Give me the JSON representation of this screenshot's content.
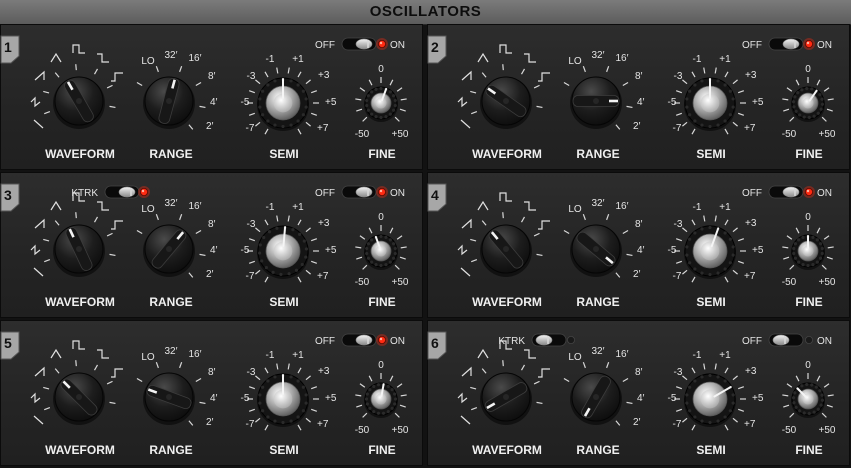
{
  "header": {
    "title": "OSCILLATORS"
  },
  "labels": {
    "waveform": "WAVEFORM",
    "range": "RANGE",
    "semi": "SEMI",
    "fine": "FINE",
    "off": "OFF",
    "on": "ON",
    "ktrk": "KTRK"
  },
  "range_marks": [
    "LO",
    "32′",
    "16′",
    "8′",
    "4′",
    "2′"
  ],
  "semi_marks": [
    "-7",
    "-5",
    "-3",
    "-1",
    "+1",
    "+3",
    "+5",
    "+7"
  ],
  "fine_marks": [
    "-50",
    "0",
    "+50"
  ],
  "oscillators": [
    {
      "number": "1",
      "power_on": true,
      "ktrk": null
    },
    {
      "number": "2",
      "power_on": true,
      "ktrk": null
    },
    {
      "number": "3",
      "power_on": true,
      "ktrk": true
    },
    {
      "number": "4",
      "power_on": true,
      "ktrk": null
    },
    {
      "number": "5",
      "power_on": true,
      "ktrk": null
    },
    {
      "number": "6",
      "power_on": false,
      "ktrk": false
    }
  ]
}
